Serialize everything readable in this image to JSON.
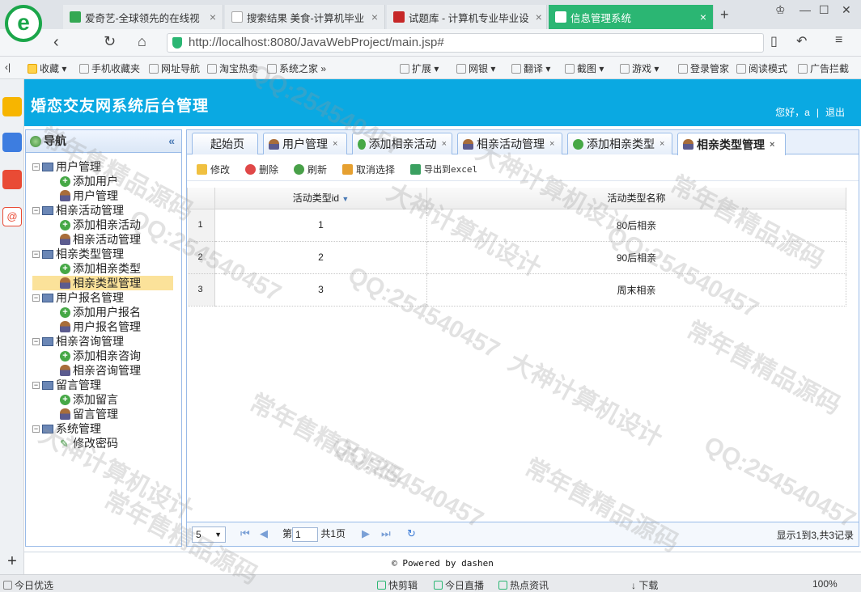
{
  "browser": {
    "tabs": [
      {
        "label": "爱奇艺-全球领先的在线视",
        "color": "#34a853"
      },
      {
        "label": "搜索结果 美食-计算机毕业",
        "color": "#9aa0a6"
      },
      {
        "label": "试题库 - 计算机专业毕业设",
        "color": "#c62828"
      },
      {
        "label": "信息管理系统",
        "color": "#ffffff"
      }
    ],
    "new_tab": "+",
    "url": "http://localhost:8080/JavaWebProject/main.jsp#",
    "bookmarks": [
      "收藏",
      "手机收藏夹",
      "网址导航",
      "淘宝热卖",
      "系统之家",
      "扩展",
      "网银",
      "翻译",
      "截图",
      "游戏",
      "登录管家",
      "阅读模式",
      "广告拦截"
    ],
    "status": {
      "left": "今日优选",
      "items": [
        "快剪辑",
        "今日直播",
        "热点资讯",
        "下载",
        "100%"
      ]
    }
  },
  "app": {
    "title": "婚恋交友网系统后台管理",
    "greeting": "您好，a",
    "separator": "|",
    "logout": "退出"
  },
  "sidebar": {
    "title": "导航",
    "collapse": "«",
    "groups": [
      {
        "label": "用户管理",
        "items": [
          {
            "label": "添加用户",
            "icon": "add-icon"
          },
          {
            "label": "用户管理",
            "icon": "user-icon"
          }
        ]
      },
      {
        "label": "相亲活动管理",
        "items": [
          {
            "label": "添加相亲活动",
            "icon": "add-icon"
          },
          {
            "label": "相亲活动管理",
            "icon": "user-icon"
          }
        ]
      },
      {
        "label": "相亲类型管理",
        "items": [
          {
            "label": "添加相亲类型",
            "icon": "add-icon"
          },
          {
            "label": "相亲类型管理",
            "icon": "user-icon",
            "selected": true
          }
        ]
      },
      {
        "label": "用户报名管理",
        "items": [
          {
            "label": "添加用户报名",
            "icon": "add-icon"
          },
          {
            "label": "用户报名管理",
            "icon": "user-icon"
          }
        ]
      },
      {
        "label": "相亲咨询管理",
        "items": [
          {
            "label": "添加相亲咨询",
            "icon": "add-icon"
          },
          {
            "label": "相亲咨询管理",
            "icon": "user-icon"
          }
        ]
      },
      {
        "label": "留言管理",
        "items": [
          {
            "label": "添加留言",
            "icon": "add-icon"
          },
          {
            "label": "留言管理",
            "icon": "user-icon"
          }
        ]
      },
      {
        "label": "系统管理",
        "items": [
          {
            "label": "修改密码",
            "icon": "pencil-icon"
          }
        ]
      }
    ]
  },
  "main": {
    "tabs": [
      {
        "label": "起始页",
        "icon": "",
        "close": ""
      },
      {
        "label": "用户管理",
        "icon": "user-icon",
        "close": "×"
      },
      {
        "label": "添加相亲活动",
        "icon": "add-icon",
        "close": "×"
      },
      {
        "label": "相亲活动管理",
        "icon": "user-icon",
        "close": "×"
      },
      {
        "label": "添加相亲类型",
        "icon": "add-icon",
        "close": "×"
      },
      {
        "label": "相亲类型管理",
        "icon": "user-icon",
        "close": "×",
        "active": true
      }
    ],
    "toolbar": {
      "edit": "修改",
      "delete": "删除",
      "refresh": "刷新",
      "deselect": "取消选择",
      "export": "导出到excel"
    },
    "grid": {
      "columns": [
        "活动类型id",
        "活动类型名称"
      ],
      "sort_indicator": "▼",
      "rows": [
        {
          "rownum": "1",
          "id": "1",
          "name": "80后相亲"
        },
        {
          "rownum": "2",
          "id": "2",
          "name": "90后相亲"
        },
        {
          "rownum": "3",
          "id": "3",
          "name": "周末相亲"
        }
      ]
    },
    "pager": {
      "page_size": "5",
      "page_prefix": "第",
      "page_value": "1",
      "page_suffix": "共1页",
      "summary": "显示1到3,共3记录"
    }
  },
  "footer": "Powered by dashen",
  "watermarks": [
    "QQ:254540457",
    "大神计算机设计",
    "常年售精品源码"
  ],
  "colors": {
    "header": "#0aa9e2",
    "active_browser_tab": "#2bb673",
    "selected_node": "#fbe29a",
    "panel_border": "#99bbe8"
  }
}
